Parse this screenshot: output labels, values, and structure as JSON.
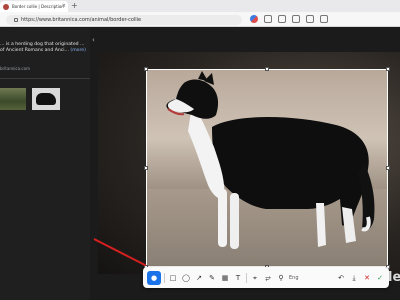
{
  "browser": {
    "tab_title": "Border collie | Description, Temp",
    "tab_close": "×",
    "new_tab": "+",
    "url": "https://www.britannica.com/animal/border-collie"
  },
  "article": {
    "description": "... is a herding dog that originated ... of Ancient Romans and Anci...",
    "more_link": "(more)",
    "source": "britannica.com"
  },
  "viewer": {
    "collapse_icon": "‹"
  },
  "toolbar": {
    "active_tool": "lens-icon",
    "ocr_label": "Eng",
    "brand_text": "le"
  },
  "colors": {
    "accent": "#1a73e8",
    "annotation_arrow": "#d62020"
  }
}
